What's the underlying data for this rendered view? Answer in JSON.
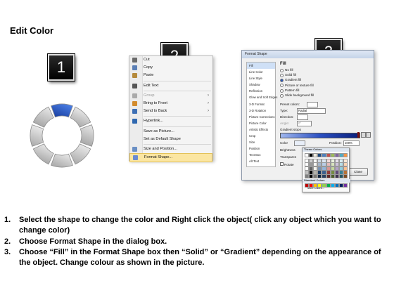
{
  "title": "Edit Color",
  "badges": [
    "1",
    "2",
    "3"
  ],
  "ring": {
    "segments": 8,
    "highlighted_segment": 1,
    "highlight_color": "#2f5fcf",
    "base_color": "#bdbdbd"
  },
  "context_menu": {
    "items": [
      {
        "label": "Cut",
        "icon": "scissors-icon",
        "disabled": false,
        "submenu": false
      },
      {
        "label": "Copy",
        "icon": "copy-icon",
        "disabled": false,
        "submenu": false
      },
      {
        "label": "Paste",
        "icon": "paste-icon",
        "disabled": false,
        "submenu": false
      },
      {
        "label": "Edit Text",
        "icon": "edit-text-icon",
        "disabled": false,
        "submenu": false
      },
      {
        "label": "Group",
        "icon": "group-icon",
        "disabled": true,
        "submenu": true
      },
      {
        "label": "Bring to Front",
        "icon": "bring-front-icon",
        "disabled": false,
        "submenu": true
      },
      {
        "label": "Send to Back",
        "icon": "send-back-icon",
        "disabled": false,
        "submenu": true
      },
      {
        "label": "Hyperlink...",
        "icon": "hyperlink-icon",
        "disabled": false,
        "submenu": false
      },
      {
        "label": "Save as Picture...",
        "icon": "",
        "disabled": false,
        "submenu": false
      },
      {
        "label": "Set as Default Shape",
        "icon": "",
        "disabled": false,
        "submenu": false
      },
      {
        "label": "Size and Position...",
        "icon": "size-position-icon",
        "disabled": false,
        "submenu": false
      },
      {
        "label": "Format Shape...",
        "icon": "format-shape-icon",
        "disabled": false,
        "submenu": false,
        "selected": true
      }
    ]
  },
  "dialog": {
    "title": "Format Shape",
    "nav": [
      "Fill",
      "Line Color",
      "Line Style",
      "Shadow",
      "Reflection",
      "Glow and Soft Edges",
      "3-D Format",
      "3-D Rotation",
      "Picture Corrections",
      "Picture Color",
      "Artistic Effects",
      "Crop",
      "Size",
      "Position",
      "Text Box",
      "Alt Text"
    ],
    "section": "Fill",
    "options": [
      "No fill",
      "Solid fill",
      "Gradient fill",
      "Picture or texture fill",
      "Pattern fill",
      "Slide background fill"
    ],
    "selected_option": 2,
    "preset_colors_label": "Preset colors:",
    "type_label": "Type:",
    "type_value": "Radial",
    "direction_label": "Direction:",
    "angle_label": "Angle:",
    "angle_value": "0°",
    "gradient_stops_label": "Gradient stops",
    "color_label": "Color",
    "position_label": "Position:",
    "position_value": "100%",
    "brightness_label": "Brightness",
    "transparency_label": "Transparen",
    "rotate_label": "Rotate",
    "close_label": "Close"
  },
  "palette": {
    "theme_label": "Theme Colors",
    "standard_label": "Standard Colors",
    "more_label": "More Colors...",
    "theme_top": [
      "#ffffff",
      "#000000",
      "#eeece1",
      "#1f497d",
      "#4f81bd",
      "#c0504d",
      "#9bbb59",
      "#8064a2",
      "#4bacc6",
      "#f79646"
    ],
    "standard": [
      "#c00000",
      "#ff0000",
      "#ffc000",
      "#ffff00",
      "#92d050",
      "#00b050",
      "#00b0f0",
      "#0070c0",
      "#002060",
      "#7030a0"
    ]
  },
  "steps": [
    {
      "num": "1.",
      "text": "Select the shape to change the color and Right click the object( click any object which you want to change color)"
    },
    {
      "num": "2.",
      "text": "Choose Format Shape in the dialog box."
    },
    {
      "num": "3.",
      "text": "Choose “Fill” in the Format Shape box then “Solid” or “Gradient” depending on the appearance of the object. Change colour as shown in the picture."
    }
  ]
}
